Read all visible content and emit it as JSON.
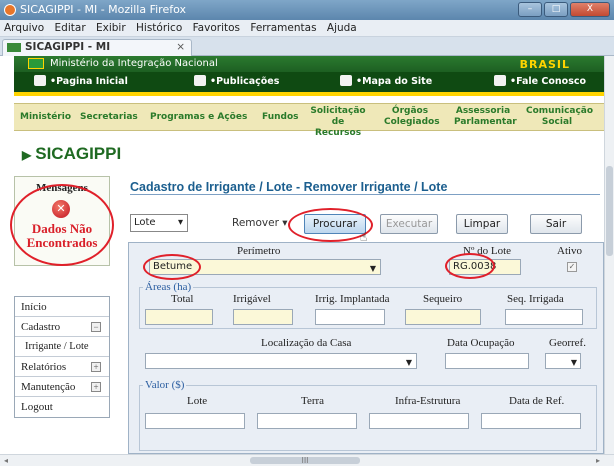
{
  "browser": {
    "window_title": "SICAGIPPI - MI - Mozilla Firefox",
    "controls": {
      "minimize": "–",
      "maximize": "□",
      "close": "X"
    },
    "menu": [
      "Arquivo",
      "Editar",
      "Exibir",
      "Histórico",
      "Favoritos",
      "Ferramentas",
      "Ajuda"
    ],
    "tab": {
      "title": "SICAGIPPI - MI",
      "close": "×"
    }
  },
  "gov": {
    "ministry": "Ministério da Integração Nacional",
    "brasil": "BRASIL",
    "nav": [
      "•Pagina Inicial",
      "•Publicações",
      "•Mapa do Site",
      "•Fale Conosco"
    ]
  },
  "mainnav": [
    "Ministério",
    "Secretarias",
    "Programas e Ações",
    "Fundos",
    "Solicitação de Recursos",
    "Órgãos Colegiados",
    "Assessoria Parlamentar",
    "Comunicação Social"
  ],
  "logo": "SICAGIPPI",
  "messages": {
    "title": "Mensagens",
    "error": "Dados Não Encontrados"
  },
  "leftmenu": [
    {
      "label": "Início"
    },
    {
      "label": "Cadastro",
      "toggle": "⊟"
    },
    {
      "label": "Irrigante / Lote"
    },
    {
      "label": "Relatórios",
      "toggle": "⊞"
    },
    {
      "label": "Manutenção",
      "toggle": "⊞"
    },
    {
      "label": "Logout"
    }
  ],
  "form": {
    "title": "Cadastro de Irrigante / Lote - Remover Irrigante / Lote",
    "entity_select": "Lote",
    "action_select": "Remover",
    "buttons": {
      "procurar": "Procurar",
      "executar": "Executar",
      "limpar": "Limpar",
      "sair": "Sair"
    },
    "perimetro_label": "Perímetro",
    "perimetro_value": "Betume",
    "lote_label": "Nº do Lote",
    "lote_value": "RG.0038",
    "ativo_label": "Ativo",
    "ativo_checked": "✓",
    "areas_legend": "Áreas (ha)",
    "areas": [
      "Total",
      "Irrigável",
      "Irrig. Implantada",
      "Sequeiro",
      "Seq. Irrigada"
    ],
    "localizacao_label": "Localização da Casa",
    "data_ocupacao_label": "Data Ocupação",
    "georef_label": "Georref.",
    "valor_legend": "Valor ($)",
    "valores": [
      "Lote",
      "Terra",
      "Infra-Estrutura",
      "Data de Ref."
    ]
  },
  "hscroll": {
    "left": "◂",
    "right": "▸",
    "thumb": "III"
  },
  "colors": {
    "error_red": "#e0202a",
    "gov_green": "#1d5f22",
    "title_blue": "#1c5f8f"
  }
}
